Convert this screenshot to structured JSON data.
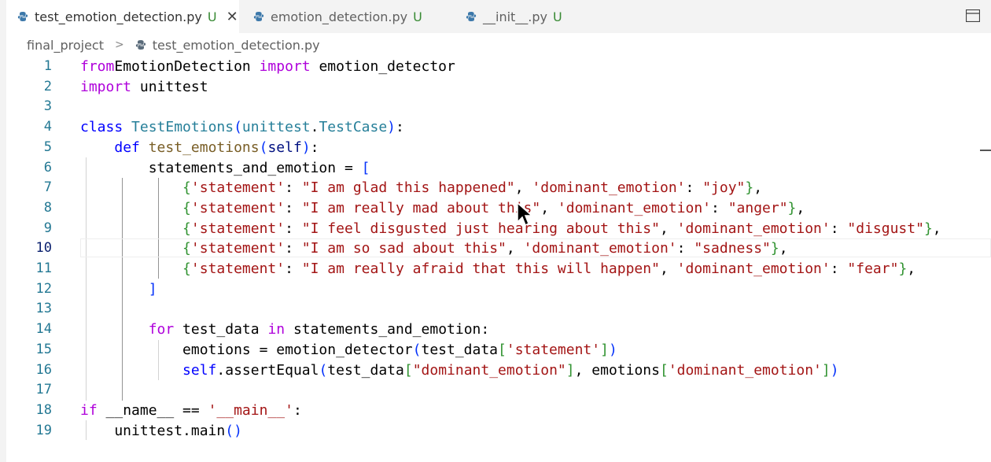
{
  "tabs": [
    {
      "label": "test_emotion_detection.py",
      "status": "U",
      "active": true
    },
    {
      "label": "emotion_detection.py",
      "status": "U",
      "active": false
    },
    {
      "label": "__init__.py",
      "status": "U",
      "active": false
    }
  ],
  "breadcrumb": {
    "folder": "final_project",
    "file": "test_emotion_detection.py"
  },
  "editor": {
    "current_line": 10,
    "lines": [
      {
        "n": "1",
        "tokens": [
          [
            "kw",
            "from"
          ],
          [
            "",
            "EmotionDetection "
          ],
          [
            "kw",
            "import"
          ],
          [
            "",
            " emotion_detector"
          ]
        ]
      },
      {
        "n": "2",
        "tokens": [
          [
            "kw",
            "import"
          ],
          [
            "",
            " unittest"
          ]
        ]
      },
      {
        "n": "3",
        "tokens": []
      },
      {
        "n": "4",
        "tokens": [
          [
            "kwb",
            "class"
          ],
          [
            "",
            " "
          ],
          [
            "cls",
            "TestEmotions"
          ],
          [
            "br1",
            "("
          ],
          [
            "cls",
            "unittest"
          ],
          [
            "",
            "."
          ],
          [
            "cls",
            "TestCase"
          ],
          [
            "br1",
            ")"
          ],
          [
            "",
            ":"
          ]
        ]
      },
      {
        "n": "5",
        "tokens": [
          [
            "",
            "    "
          ],
          [
            "kwb",
            "def"
          ],
          [
            "",
            " "
          ],
          [
            "fn",
            "test_emotions"
          ],
          [
            "br1",
            "("
          ],
          [
            "var",
            "self"
          ],
          [
            "br1",
            ")"
          ],
          [
            "",
            ":"
          ]
        ]
      },
      {
        "n": "6",
        "tokens": [
          [
            "",
            "        statements_and_emotion = "
          ],
          [
            "br1",
            "["
          ]
        ]
      },
      {
        "n": "7",
        "tokens": [
          [
            "",
            "            "
          ],
          [
            "br2",
            "{"
          ],
          [
            "str",
            "'statement'"
          ],
          [
            "",
            ": "
          ],
          [
            "str",
            "\"I am glad this happened\""
          ],
          [
            "",
            ", "
          ],
          [
            "str",
            "'dominant_emotion'"
          ],
          [
            "",
            ": "
          ],
          [
            "str",
            "\"joy\""
          ],
          [
            "br2",
            "}"
          ],
          [
            "",
            ","
          ]
        ]
      },
      {
        "n": "8",
        "tokens": [
          [
            "",
            "            "
          ],
          [
            "br2",
            "{"
          ],
          [
            "str",
            "'statement'"
          ],
          [
            "",
            ": "
          ],
          [
            "str",
            "\"I am really mad about this\""
          ],
          [
            "",
            ", "
          ],
          [
            "str",
            "'dominant_emotion'"
          ],
          [
            "",
            ": "
          ],
          [
            "str",
            "\"anger\""
          ],
          [
            "br2",
            "}"
          ],
          [
            "",
            ","
          ]
        ]
      },
      {
        "n": "9",
        "tokens": [
          [
            "",
            "            "
          ],
          [
            "br2",
            "{"
          ],
          [
            "str",
            "'statement'"
          ],
          [
            "",
            ": "
          ],
          [
            "str",
            "\"I feel disgusted just hearing about this\""
          ],
          [
            "",
            ", "
          ],
          [
            "str",
            "'dominant_emotion'"
          ],
          [
            "",
            ": "
          ],
          [
            "str",
            "\"disgust\""
          ],
          [
            "br2",
            "}"
          ],
          [
            "",
            ","
          ]
        ]
      },
      {
        "n": "10",
        "tokens": [
          [
            "",
            "            "
          ],
          [
            "br2",
            "{"
          ],
          [
            "str",
            "'statement'"
          ],
          [
            "",
            ": "
          ],
          [
            "str",
            "\"I am so sad about this\""
          ],
          [
            "",
            ", "
          ],
          [
            "str",
            "'dominant_emotion'"
          ],
          [
            "",
            ": "
          ],
          [
            "str",
            "\"sadness\""
          ],
          [
            "br2",
            "}"
          ],
          [
            "",
            ","
          ]
        ]
      },
      {
        "n": "11",
        "tokens": [
          [
            "",
            "            "
          ],
          [
            "br2",
            "{"
          ],
          [
            "str",
            "'statement'"
          ],
          [
            "",
            ": "
          ],
          [
            "str",
            "\"I am really afraid that this will happen\""
          ],
          [
            "",
            ", "
          ],
          [
            "str",
            "'dominant_emotion'"
          ],
          [
            "",
            ": "
          ],
          [
            "str",
            "\"fear\""
          ],
          [
            "br2",
            "}"
          ],
          [
            "",
            ","
          ]
        ]
      },
      {
        "n": "12",
        "tokens": [
          [
            "",
            "        "
          ],
          [
            "br1",
            "]"
          ]
        ]
      },
      {
        "n": "13",
        "tokens": []
      },
      {
        "n": "14",
        "tokens": [
          [
            "",
            "        "
          ],
          [
            "kw",
            "for"
          ],
          [
            "",
            " test_data "
          ],
          [
            "kw",
            "in"
          ],
          [
            "",
            " statements_and_emotion:"
          ]
        ]
      },
      {
        "n": "15",
        "tokens": [
          [
            "",
            "            emotions = emotion_detector"
          ],
          [
            "br1",
            "("
          ],
          [
            "",
            "test_data"
          ],
          [
            "br2",
            "["
          ],
          [
            "str",
            "'statement'"
          ],
          [
            "br2",
            "]"
          ],
          [
            "br1",
            ")"
          ]
        ]
      },
      {
        "n": "16",
        "tokens": [
          [
            "",
            "            "
          ],
          [
            "kwb",
            "self"
          ],
          [
            "",
            ".assertEqual"
          ],
          [
            "br1",
            "("
          ],
          [
            "",
            "test_data"
          ],
          [
            "br2",
            "["
          ],
          [
            "str",
            "\"dominant_emotion\""
          ],
          [
            "br2",
            "]"
          ],
          [
            "",
            ", emotions"
          ],
          [
            "br2",
            "["
          ],
          [
            "str",
            "'dominant_emotion'"
          ],
          [
            "br2",
            "]"
          ],
          [
            "br1",
            ")"
          ]
        ]
      },
      {
        "n": "17",
        "tokens": []
      },
      {
        "n": "18",
        "tokens": [
          [
            "kw",
            "if"
          ],
          [
            "",
            " __name__ == "
          ],
          [
            "str",
            "'__main__'"
          ],
          [
            "",
            ":"
          ]
        ]
      },
      {
        "n": "19",
        "tokens": [
          [
            "",
            "    unittest.main"
          ],
          [
            "br1",
            "()"
          ]
        ]
      }
    ]
  }
}
